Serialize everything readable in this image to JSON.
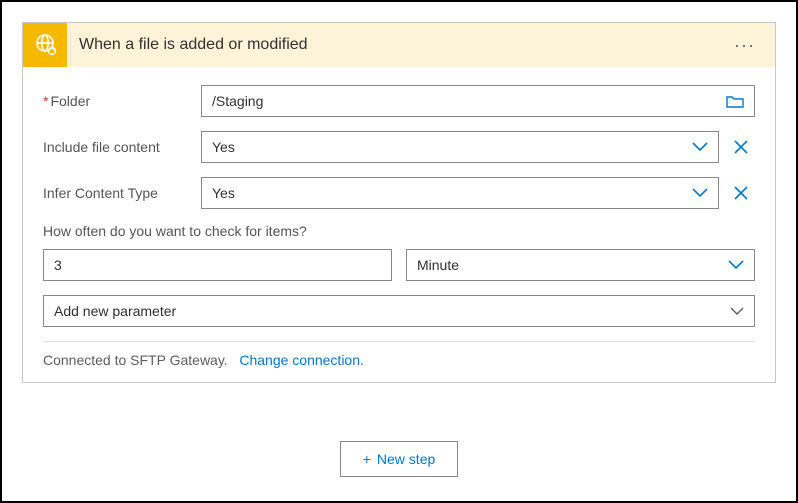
{
  "card": {
    "title": "When a file is added or modified",
    "fields": {
      "folder": {
        "label": "Folder",
        "value": "/Staging",
        "required": true
      },
      "includeFileContent": {
        "label": "Include file content",
        "value": "Yes"
      },
      "inferContentType": {
        "label": "Infer Content Type",
        "value": "Yes"
      }
    },
    "frequency": {
      "question": "How often do you want to check for items?",
      "interval": "3",
      "unit": "Minute"
    },
    "addParameter": {
      "label": "Add new parameter"
    },
    "connection": {
      "status": "Connected to SFTP Gateway.",
      "changeLink": "Change connection."
    }
  },
  "newStep": {
    "label": "New step"
  },
  "colors": {
    "accent": "#0078d4",
    "headerBg": "#fdf3d9",
    "iconBg": "#f5b900"
  }
}
